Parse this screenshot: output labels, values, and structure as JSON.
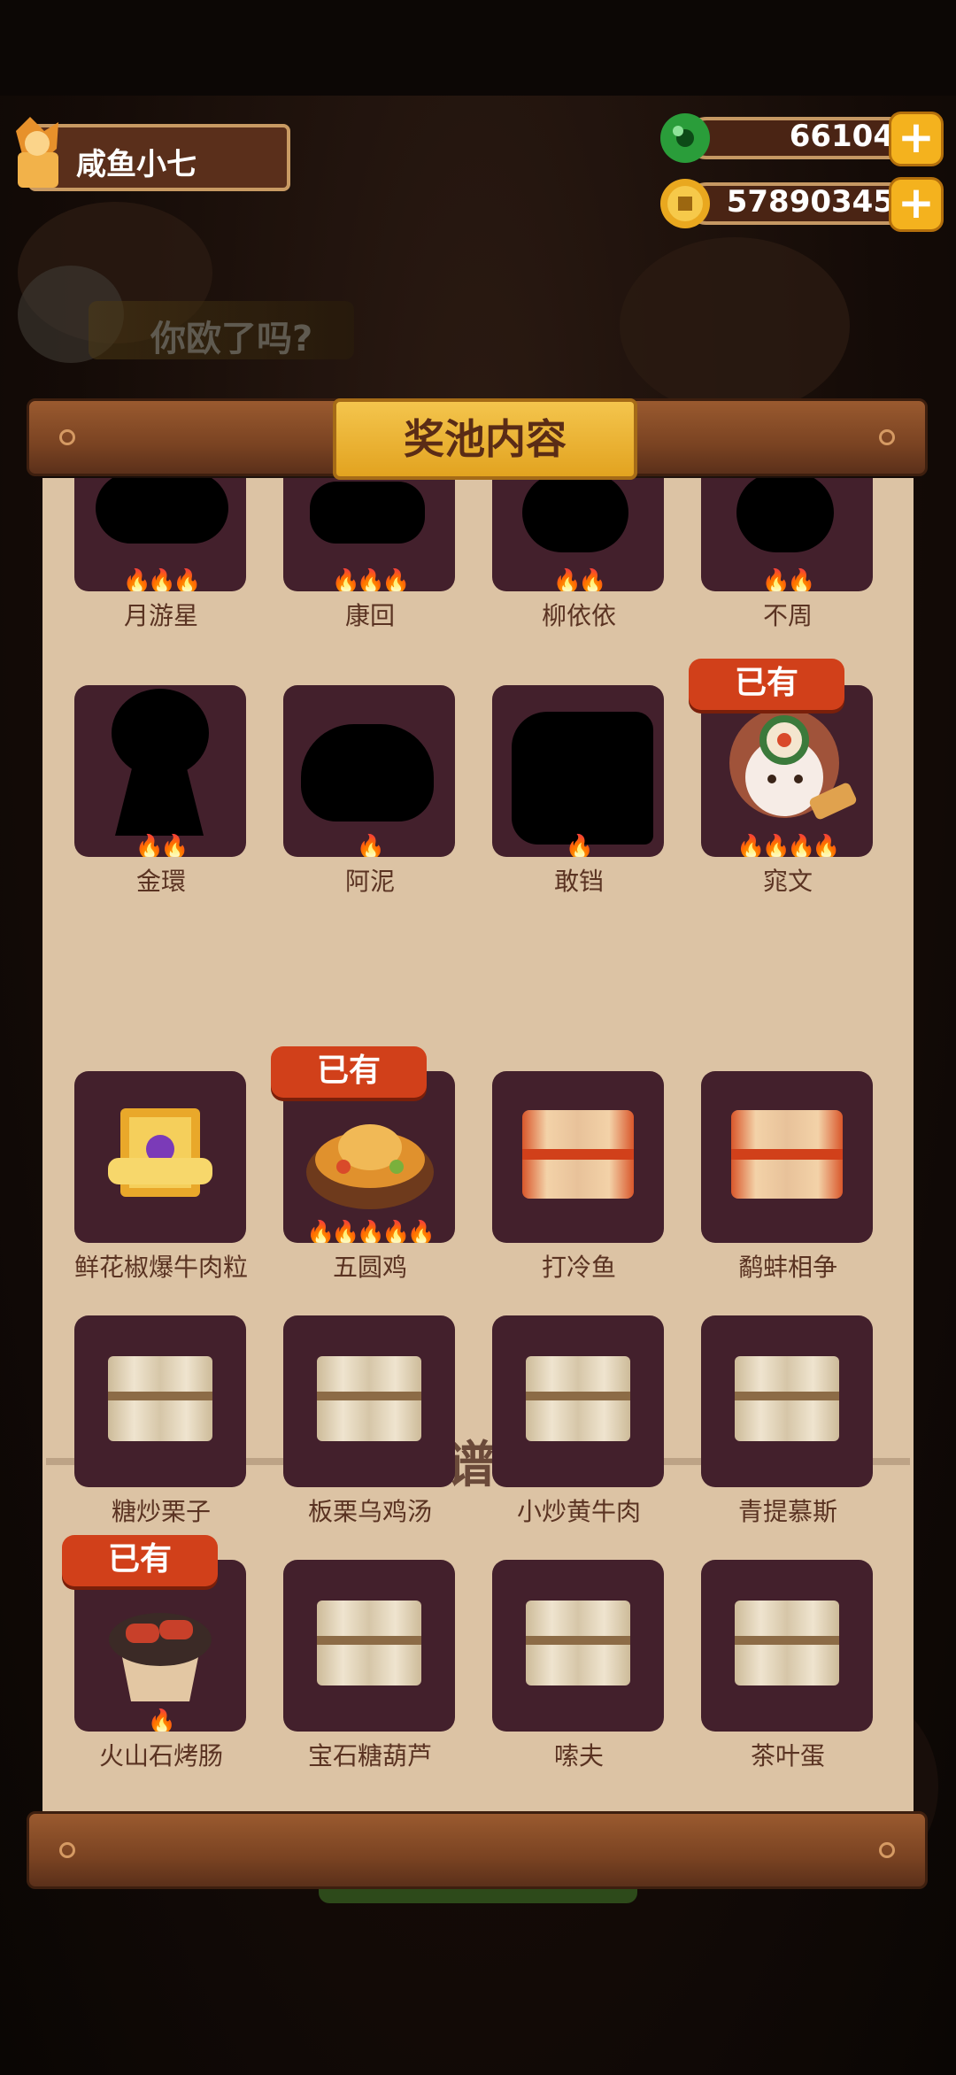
{
  "header": {
    "player_name": "咸鱼小七",
    "jade": "66104",
    "coins": "57890345",
    "plus": "+"
  },
  "background_banner": "你欧了吗?",
  "panel": {
    "title": "奖池内容",
    "characters": [
      {
        "name": "月游星",
        "stars": 3,
        "owned": false
      },
      {
        "name": "康回",
        "stars": 3,
        "owned": false
      },
      {
        "name": "柳依依",
        "stars": 2,
        "owned": false
      },
      {
        "name": "不周",
        "stars": 2,
        "owned": false
      },
      {
        "name": "金環",
        "stars": 2,
        "owned": false
      },
      {
        "name": "阿泥",
        "stars": 1,
        "owned": false
      },
      {
        "name": "敢铛",
        "stars": 1,
        "owned": false
      },
      {
        "name": "窕文",
        "stars": 4,
        "owned": true
      }
    ],
    "section_title": "菜谱",
    "help": "?",
    "owned_label": "已有",
    "recipes": [
      {
        "name": "鲜花椒爆牛肉粒",
        "owned": false
      },
      {
        "name": "五圆鸡",
        "owned": true
      },
      {
        "name": "打冷鱼",
        "owned": false
      },
      {
        "name": "鹬蚌相争",
        "owned": false
      },
      {
        "name": "糖炒栗子",
        "owned": false
      },
      {
        "name": "板栗乌鸡汤",
        "owned": false
      },
      {
        "name": "小炒黄牛肉",
        "owned": false
      },
      {
        "name": "青提慕斯",
        "owned": false
      },
      {
        "name": "火山石烤肠",
        "owned": true
      },
      {
        "name": "宝石糖葫芦",
        "owned": false
      },
      {
        "name": "嗦夫",
        "owned": false
      },
      {
        "name": "茶叶蛋",
        "owned": false
      }
    ]
  }
}
